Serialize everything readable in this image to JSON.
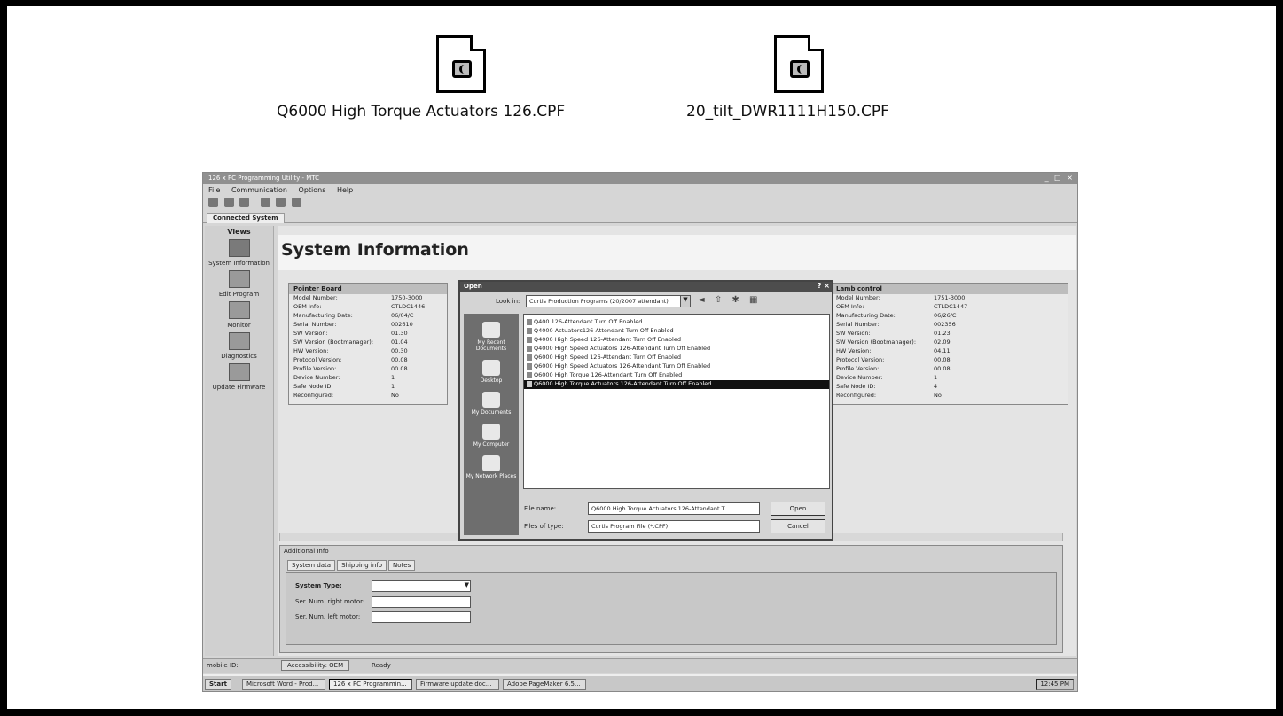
{
  "files": [
    {
      "name": "Q6000 High Torque Actuators 126.CPF",
      "icon": "cpf-file-icon"
    },
    {
      "name": "20_tilt_DWR1111H150.CPF",
      "icon": "cpf-file-icon"
    }
  ],
  "app": {
    "title": "126 x PC Programming Utility - MTC",
    "window_controls": "_ □ ×",
    "menu": [
      "File",
      "Communication",
      "Options",
      "Help"
    ],
    "tab": "Connected System",
    "views_header": "Views",
    "views": [
      "System Information",
      "Edit Program",
      "Monitor",
      "Diagnostics",
      "Update Firmware"
    ],
    "page_title": "System Information",
    "left_panel": {
      "title": "Pointer Board",
      "rows": [
        [
          "Model Number:",
          "1750-3000"
        ],
        [
          "OEM Info:",
          "CTLDC1446"
        ],
        [
          "Manufacturing Date:",
          "06/04/C"
        ],
        [
          "Serial Number:",
          "002610"
        ],
        [
          "SW Version:",
          "01.30"
        ],
        [
          "SW Version (Bootmanager):",
          "01.04"
        ],
        [
          "HW Version:",
          "00.30"
        ],
        [
          "Protocol Version:",
          "00.08"
        ],
        [
          "Profile Version:",
          "00.08"
        ],
        [
          "Device Number:",
          "1"
        ],
        [
          "Safe Node ID:",
          "1"
        ],
        [
          "Reconfigured:",
          "No"
        ]
      ]
    },
    "right_panel": {
      "title": "Lamb control",
      "rows": [
        [
          "Model Number:",
          "1751-3000"
        ],
        [
          "OEM Info:",
          "CTLDC1447"
        ],
        [
          "Manufacturing Date:",
          "06/26/C"
        ],
        [
          "Serial Number:",
          "002356"
        ],
        [
          "SW Version:",
          "01.23"
        ],
        [
          "SW Version (Bootmanager):",
          "02.09"
        ],
        [
          "HW Version:",
          "04.11"
        ],
        [
          "Protocol Version:",
          "00.08"
        ],
        [
          "Profile Version:",
          "00.08"
        ],
        [
          "Device Number:",
          "1"
        ],
        [
          "Safe Node ID:",
          "4"
        ],
        [
          "Reconfigured:",
          "No"
        ]
      ]
    },
    "additional_info": {
      "legend": "Additional Info",
      "subtabs": [
        "System data",
        "Shipping info",
        "Notes"
      ],
      "fields": [
        "System Type:",
        "Ser. Num. right motor:",
        "Ser. Num. left motor:"
      ]
    },
    "status": [
      "mobile ID:",
      "Accessibility: OEM",
      "Ready"
    ],
    "taskbar": {
      "start": "Start",
      "tasks": [
        "Microsoft Word - Prod...",
        "126 x PC Programmin...",
        "Firmware update doc...",
        "Adobe PageMaker 6.5..."
      ],
      "clock": "12:45 PM"
    }
  },
  "dialog": {
    "title": "Open",
    "close": "? ×",
    "look_in_label": "Look in:",
    "look_in_value": "Curtis Production Programs (20/2007 attendant)",
    "places": [
      "My Recent Documents",
      "Desktop",
      "My Documents",
      "My Computer",
      "My Network Places"
    ],
    "files": [
      "Q400 126-Attendant Turn Off Enabled",
      "Q4000 Actuators126-Attendant Turn Off Enabled",
      "Q4000 High Speed 126-Attendant Turn Off Enabled",
      "Q4000 High Speed Actuators 126-Attendant Turn Off Enabled",
      "Q6000 High Speed 126-Attendant Turn Off Enabled",
      "Q6000 High Speed Actuators 126-Attendant Turn Off Enabled",
      "Q6000 High Torque 126-Attendant Turn Off Enabled",
      "Q6000 High Torque Actuators 126-Attendant Turn Off Enabled"
    ],
    "selected_index": 7,
    "file_name_label": "File name:",
    "file_name_value": "Q6000 High Torque Actuators 126-Attendant T",
    "file_type_label": "Files of type:",
    "file_type_value": "Curtis Program File (*.CPF)",
    "open_label": "Open",
    "cancel_label": "Cancel"
  }
}
